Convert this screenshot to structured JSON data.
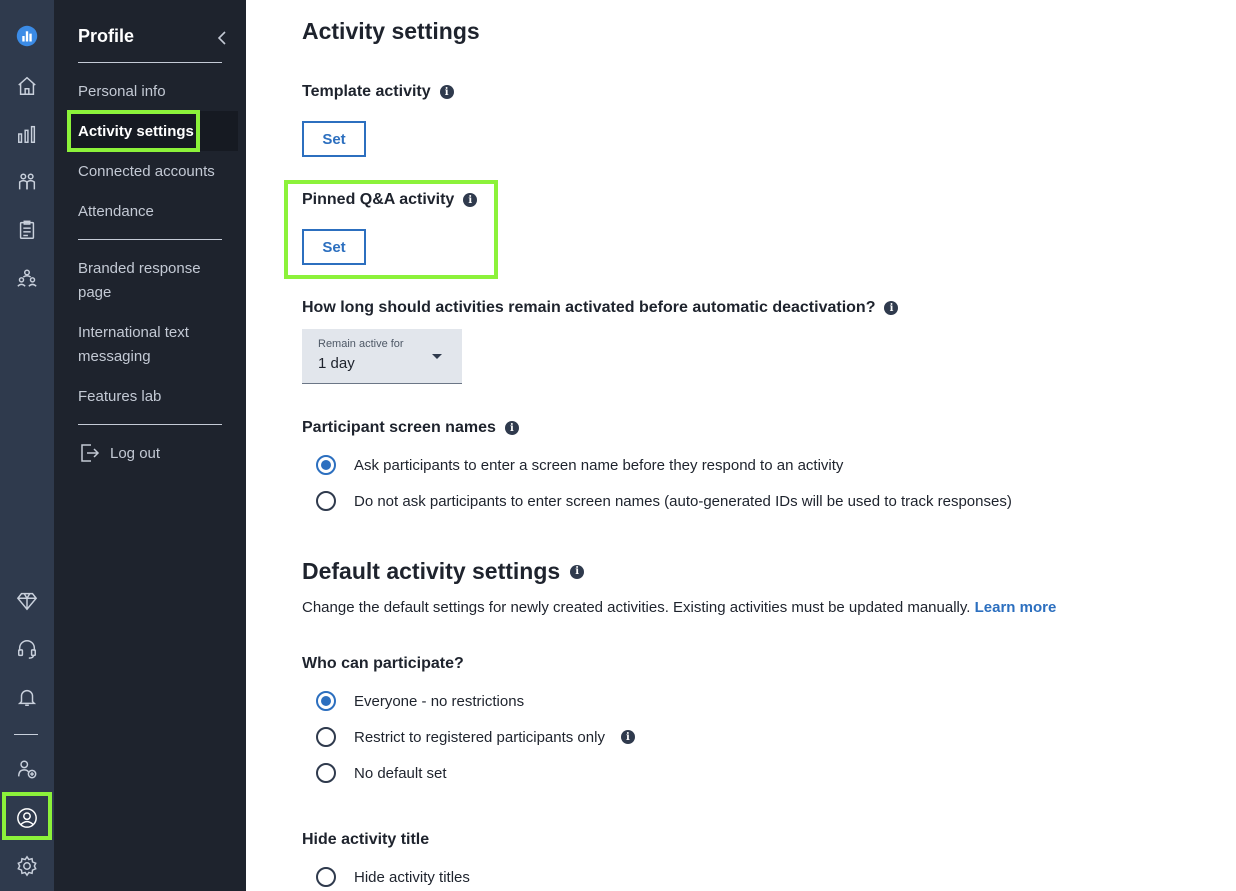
{
  "rail": {
    "items": [
      {
        "name": "app-logo-icon",
        "label": "logo"
      },
      {
        "name": "home-icon"
      },
      {
        "name": "chart-icon"
      },
      {
        "name": "participants-icon"
      },
      {
        "name": "clipboard-icon"
      },
      {
        "name": "audience-icon"
      },
      {
        "name": "diamond-icon"
      },
      {
        "name": "headset-icon"
      },
      {
        "name": "bell-icon"
      },
      {
        "name": "add-user-icon"
      },
      {
        "name": "profile-icon"
      },
      {
        "name": "settings-icon"
      }
    ],
    "active_color": "#8cf23a"
  },
  "panel": {
    "title": "Profile",
    "items": [
      {
        "label": "Personal info"
      },
      {
        "label": "Activity settings"
      },
      {
        "label": "Connected accounts"
      },
      {
        "label": "Attendance"
      },
      {
        "label": "Branded response page"
      },
      {
        "label": "International text messaging"
      },
      {
        "label": "Features lab"
      }
    ],
    "logout_label": "Log out"
  },
  "main": {
    "title": "Activity settings",
    "template_activity": {
      "label": "Template activity",
      "button": "Set"
    },
    "pinned_qa": {
      "label": "Pinned Q&A activity",
      "button": "Set"
    },
    "auto_deactivation": {
      "label": "How long should activities remain activated before automatic deactivation?",
      "select_label": "Remain active for",
      "select_value": "1 day"
    },
    "screen_names": {
      "label": "Participant screen names",
      "options": [
        {
          "label": "Ask participants to enter a screen name before they respond to an activity",
          "checked": true
        },
        {
          "label": "Do not ask participants to enter screen names (auto-generated IDs will be used to track responses)",
          "checked": false
        }
      ]
    },
    "defaults": {
      "title": "Default activity settings",
      "description": "Change the default settings for newly created activities. Existing activities must be updated manually.",
      "learn_more": "Learn more"
    },
    "who_can_participate": {
      "label": "Who can participate?",
      "options": [
        {
          "label": "Everyone - no restrictions",
          "checked": true
        },
        {
          "label": "Restrict to registered participants only",
          "checked": false
        },
        {
          "label": "No default set",
          "checked": false
        }
      ]
    },
    "hide_title": {
      "label": "Hide activity title",
      "options": [
        {
          "label": "Hide activity titles",
          "checked": false
        }
      ]
    }
  },
  "colors": {
    "rail_bg": "#2f3a4d",
    "panel_bg": "#1e232d",
    "accent": "#2c6fbf",
    "highlight": "#8cf23a"
  }
}
